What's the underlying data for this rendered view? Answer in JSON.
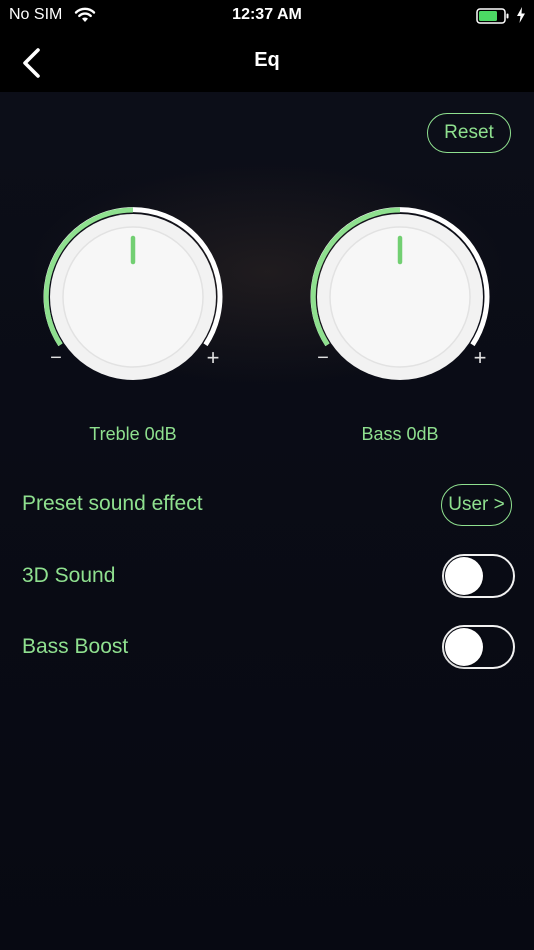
{
  "status_bar": {
    "carrier": "No SIM",
    "time": "12:37 AM",
    "battery_level": 0.75,
    "icons": [
      "wifi-icon",
      "battery-icon",
      "charging-bolt-icon"
    ]
  },
  "nav": {
    "title": "Eq",
    "back_icon": "chevron-left-icon"
  },
  "reset_label": "Reset",
  "knobs": [
    {
      "id": "treble",
      "label": "Treble 0dB",
      "value_db": 0,
      "minus": "−",
      "plus": "+"
    },
    {
      "id": "bass",
      "label": "Bass 0dB",
      "value_db": 0,
      "minus": "−",
      "plus": "+"
    }
  ],
  "preset": {
    "label": "Preset sound effect",
    "button_label": "User >"
  },
  "toggles": [
    {
      "label": "3D Sound",
      "on": false
    },
    {
      "label": "Bass Boost",
      "on": false
    }
  ],
  "colors": {
    "accent": "#8fe08f",
    "background": "#080a14",
    "bar": "#000000",
    "text": "#ffffff"
  }
}
